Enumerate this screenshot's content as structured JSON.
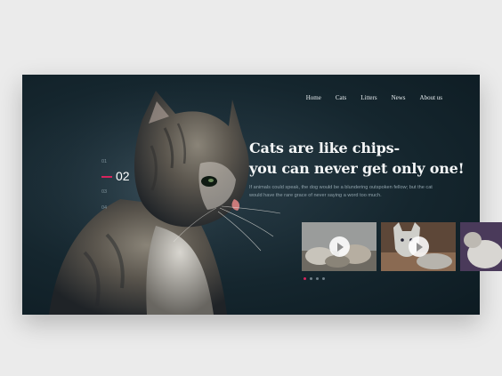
{
  "nav": {
    "items": [
      {
        "label": "Home"
      },
      {
        "label": "Cats"
      },
      {
        "label": "Litters"
      },
      {
        "label": "News"
      },
      {
        "label": "About us"
      }
    ]
  },
  "hero": {
    "headline_line1": "Cats are like chips-",
    "headline_line2": "you can never get only one!",
    "tagline": "If animals could speak, the dog would be a blundering outspoken fellow; but the cat would have the rare grace of never saying a word too much."
  },
  "pager": {
    "items": [
      {
        "label": "01"
      },
      {
        "label": "02"
      },
      {
        "label": "03"
      },
      {
        "label": "04"
      }
    ],
    "active": "02"
  },
  "gallery": {
    "videos": [
      {
        "icon": "play-icon"
      },
      {
        "icon": "play-icon"
      },
      {
        "icon": "play-icon"
      }
    ],
    "dots": 4,
    "active_dot": 1
  },
  "colors": {
    "accent": "#d6245d",
    "background": "#0d1b22",
    "page": "#ebebeb"
  }
}
